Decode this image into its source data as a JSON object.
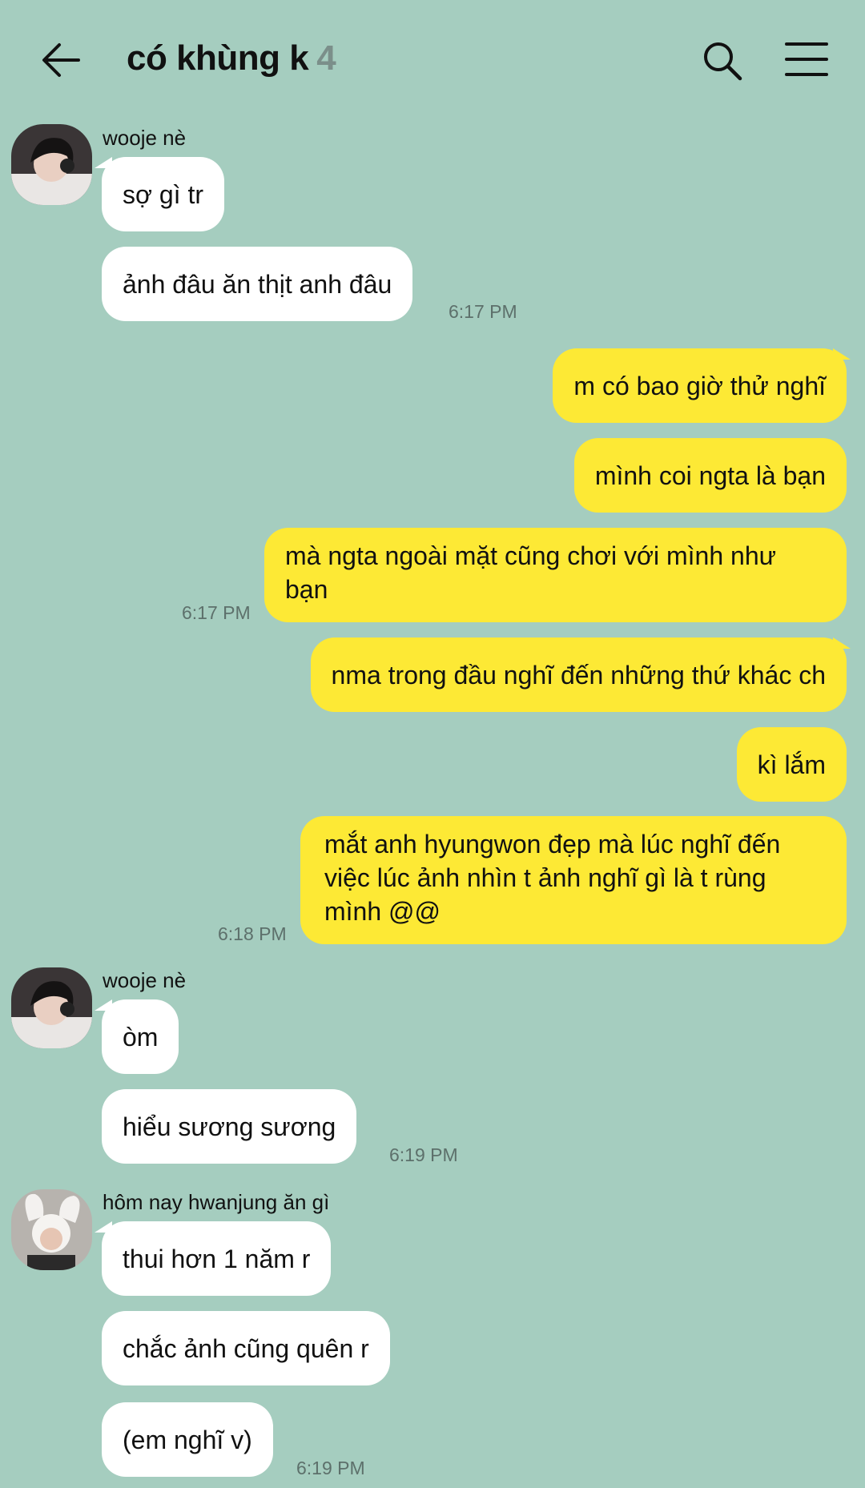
{
  "header": {
    "title": "có khùng k",
    "member_count": "4",
    "back_icon": "arrow-left-icon",
    "search_icon": "search-icon",
    "menu_icon": "menu-icon"
  },
  "messages": {
    "g1": {
      "sender": "wooje nè",
      "b1": "sợ gì tr",
      "b2": "ảnh đâu ăn thịt anh đâu",
      "time": "6:17 PM"
    },
    "me1": {
      "b1": "m có bao giờ thử nghĩ",
      "b2": "mình coi ngta là bạn",
      "b3": "mà ngta ngoài mặt cũng chơi với mình như bạn",
      "time": "6:17 PM"
    },
    "me2": {
      "b1": "nma trong đầu nghĩ đến những thứ khác ch",
      "b2": "kì lắm",
      "b3": "mắt anh hyungwon đẹp mà lúc nghĩ đến việc lúc ảnh nhìn t ảnh nghĩ gì là t rùng mình @@",
      "time": "6:18 PM"
    },
    "g2": {
      "sender": "wooje nè",
      "b1": "òm",
      "b2": "hiểu sương sương",
      "time": "6:19 PM"
    },
    "g3": {
      "sender": "hôm nay hwanjung ăn gì",
      "b1": "thui hơn 1 năm r",
      "b2": "chắc ảnh cũng quên r",
      "b3": "(em nghĩ v)",
      "time": "6:19 PM"
    }
  },
  "colors": {
    "background": "#a5cdbf",
    "incoming": "#ffffff",
    "outgoing": "#fde935"
  }
}
